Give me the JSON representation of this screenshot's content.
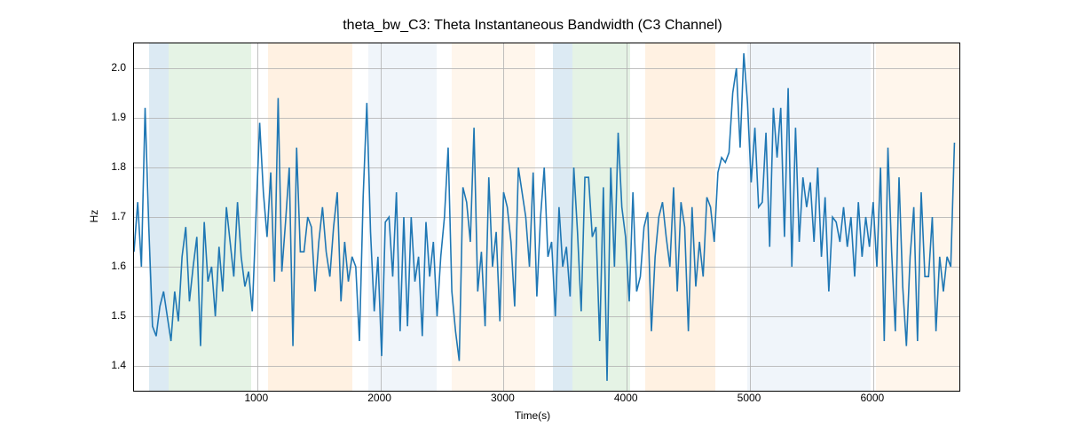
{
  "chart_data": {
    "type": "line",
    "title": "theta_bw_C3: Theta Instantaneous Bandwidth (C3 Channel)",
    "xlabel": "Time(s)",
    "ylabel": "Hz",
    "xlim": [
      0,
      6700
    ],
    "ylim": [
      1.35,
      2.05
    ],
    "x_ticks": [
      1000,
      2000,
      3000,
      4000,
      5000,
      6000
    ],
    "y_ticks": [
      1.4,
      1.5,
      1.6,
      1.7,
      1.8,
      1.9,
      2.0
    ],
    "bands": [
      {
        "start": 120,
        "end": 280,
        "color": "#9cc2de"
      },
      {
        "start": 280,
        "end": 950,
        "color": "#b4dcb4"
      },
      {
        "start": 1090,
        "end": 1770,
        "color": "#ffd6ab"
      },
      {
        "start": 1900,
        "end": 2460,
        "color": "#d5e2f0"
      },
      {
        "start": 2580,
        "end": 3260,
        "color": "#ffe4c8"
      },
      {
        "start": 3400,
        "end": 3560,
        "color": "#9cc2de"
      },
      {
        "start": 3560,
        "end": 4030,
        "color": "#b4dcb4"
      },
      {
        "start": 4150,
        "end": 4720,
        "color": "#ffd6ab"
      },
      {
        "start": 4980,
        "end": 5980,
        "color": "#d5e2f0"
      },
      {
        "start": 6020,
        "end": 6700,
        "color": "#ffe4c8"
      }
    ],
    "series": [
      {
        "name": "theta_bw_C3",
        "color": "#1f77b4",
        "x": [
          0,
          30,
          60,
          90,
          120,
          150,
          180,
          210,
          240,
          270,
          300,
          330,
          360,
          390,
          420,
          450,
          480,
          510,
          540,
          570,
          600,
          630,
          660,
          690,
          720,
          750,
          780,
          810,
          840,
          870,
          900,
          930,
          960,
          990,
          1020,
          1050,
          1080,
          1110,
          1140,
          1170,
          1200,
          1230,
          1260,
          1290,
          1320,
          1350,
          1380,
          1410,
          1440,
          1470,
          1500,
          1530,
          1560,
          1590,
          1620,
          1650,
          1680,
          1710,
          1740,
          1770,
          1800,
          1830,
          1860,
          1890,
          1920,
          1950,
          1980,
          2010,
          2040,
          2070,
          2100,
          2130,
          2160,
          2190,
          2220,
          2250,
          2280,
          2310,
          2340,
          2370,
          2400,
          2430,
          2460,
          2490,
          2520,
          2550,
          2580,
          2610,
          2640,
          2670,
          2700,
          2730,
          2760,
          2790,
          2820,
          2850,
          2880,
          2910,
          2940,
          2970,
          3000,
          3030,
          3060,
          3090,
          3120,
          3150,
          3180,
          3210,
          3240,
          3270,
          3300,
          3330,
          3360,
          3390,
          3420,
          3450,
          3480,
          3510,
          3540,
          3570,
          3600,
          3630,
          3660,
          3690,
          3720,
          3750,
          3780,
          3810,
          3840,
          3870,
          3900,
          3930,
          3960,
          3990,
          4020,
          4050,
          4080,
          4110,
          4140,
          4170,
          4200,
          4230,
          4260,
          4290,
          4320,
          4350,
          4380,
          4410,
          4440,
          4470,
          4500,
          4530,
          4560,
          4590,
          4620,
          4650,
          4680,
          4710,
          4740,
          4770,
          4800,
          4830,
          4860,
          4890,
          4920,
          4950,
          4980,
          5010,
          5040,
          5070,
          5100,
          5130,
          5160,
          5190,
          5220,
          5250,
          5280,
          5310,
          5340,
          5370,
          5400,
          5430,
          5460,
          5490,
          5520,
          5550,
          5580,
          5610,
          5640,
          5670,
          5700,
          5730,
          5760,
          5790,
          5820,
          5850,
          5880,
          5910,
          5940,
          5970,
          6000,
          6030,
          6060,
          6090,
          6120,
          6150,
          6180,
          6210,
          6240,
          6270,
          6300,
          6330,
          6360,
          6390,
          6420,
          6450,
          6480,
          6510,
          6540,
          6570,
          6600,
          6630,
          6660,
          6690
        ],
        "y": [
          1.63,
          1.73,
          1.6,
          1.92,
          1.68,
          1.48,
          1.46,
          1.52,
          1.55,
          1.5,
          1.45,
          1.55,
          1.49,
          1.62,
          1.68,
          1.53,
          1.6,
          1.66,
          1.44,
          1.69,
          1.57,
          1.6,
          1.5,
          1.64,
          1.55,
          1.72,
          1.65,
          1.58,
          1.73,
          1.62,
          1.56,
          1.59,
          1.51,
          1.7,
          1.89,
          1.75,
          1.66,
          1.79,
          1.57,
          1.94,
          1.59,
          1.69,
          1.8,
          1.44,
          1.84,
          1.63,
          1.63,
          1.7,
          1.68,
          1.55,
          1.65,
          1.72,
          1.63,
          1.58,
          1.68,
          1.75,
          1.53,
          1.65,
          1.57,
          1.62,
          1.6,
          1.45,
          1.74,
          1.93,
          1.67,
          1.51,
          1.62,
          1.42,
          1.69,
          1.7,
          1.58,
          1.75,
          1.47,
          1.7,
          1.48,
          1.7,
          1.57,
          1.62,
          1.46,
          1.69,
          1.58,
          1.65,
          1.5,
          1.62,
          1.7,
          1.84,
          1.55,
          1.47,
          1.41,
          1.76,
          1.73,
          1.65,
          1.88,
          1.55,
          1.63,
          1.48,
          1.78,
          1.6,
          1.67,
          1.49,
          1.75,
          1.72,
          1.65,
          1.52,
          1.8,
          1.75,
          1.7,
          1.6,
          1.79,
          1.54,
          1.7,
          1.8,
          1.62,
          1.65,
          1.5,
          1.72,
          1.6,
          1.64,
          1.54,
          1.8,
          1.67,
          1.51,
          1.78,
          1.78,
          1.66,
          1.68,
          1.45,
          1.76,
          1.37,
          1.8,
          1.6,
          1.87,
          1.72,
          1.66,
          1.53,
          1.75,
          1.55,
          1.58,
          1.68,
          1.71,
          1.47,
          1.62,
          1.7,
          1.73,
          1.66,
          1.6,
          1.76,
          1.55,
          1.73,
          1.68,
          1.47,
          1.72,
          1.56,
          1.65,
          1.58,
          1.74,
          1.72,
          1.65,
          1.79,
          1.82,
          1.81,
          1.83,
          1.95,
          2.0,
          1.84,
          2.03,
          1.93,
          1.77,
          1.88,
          1.72,
          1.73,
          1.87,
          1.64,
          1.92,
          1.82,
          1.92,
          1.66,
          1.96,
          1.6,
          1.88,
          1.65,
          1.78,
          1.72,
          1.77,
          1.65,
          1.8,
          1.62,
          1.74,
          1.55,
          1.7,
          1.69,
          1.65,
          1.72,
          1.64,
          1.7,
          1.58,
          1.73,
          1.62,
          1.7,
          1.64,
          1.73,
          1.6,
          1.8,
          1.45,
          1.84,
          1.63,
          1.47,
          1.78,
          1.56,
          1.44,
          1.62,
          1.72,
          1.45,
          1.75,
          1.58,
          1.58,
          1.7,
          1.47,
          1.62,
          1.55,
          1.62,
          1.6,
          1.85
        ]
      }
    ]
  }
}
